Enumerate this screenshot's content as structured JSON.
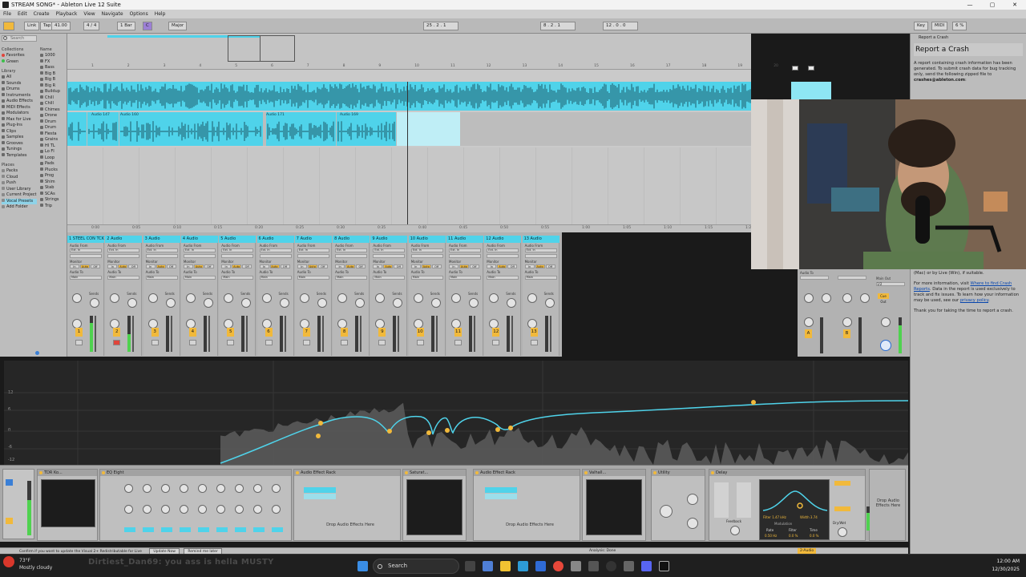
{
  "window": {
    "title": "STREAM SONG* - Ableton Live 12 Suite",
    "min": "—",
    "max": "▢",
    "close": "✕"
  },
  "menu": [
    "File",
    "Edit",
    "Create",
    "Playback",
    "View",
    "Navigate",
    "Options",
    "Help"
  ],
  "transport": {
    "link": "Link",
    "tap": "Tap",
    "tempo": "41.00",
    "signature": "4 / 4",
    "quantize": "1 Bar",
    "key": "C",
    "scale": "Major",
    "position": "25 . 2 . 1",
    "loop_start": "8 . 2 . 1",
    "loop_length": "12 . 0 . 0",
    "key_map": "Key",
    "midi_map": "MIDI",
    "cpu": "6 %"
  },
  "browser": {
    "search_placeholder": "Search",
    "name_header": "Name",
    "collections_header": "Collections",
    "collections": [
      {
        "label": "Favorites",
        "color": "#e0443a"
      },
      {
        "label": "Green",
        "color": "#3cbf4a"
      }
    ],
    "library_header": "Library",
    "library": [
      "All",
      "Sounds",
      "Drums",
      "Instruments",
      "Audio Effects",
      "MIDI Effects",
      "Modulators",
      "Max for Live",
      "Plug-Ins",
      "Clips",
      "Samples",
      "Grooves",
      "Tunings",
      "Templates"
    ],
    "places_header": "Places",
    "places": [
      "Packs",
      "Cloud",
      "Push",
      "User Library",
      "Current Project",
      "Vocal Presets",
      "Add Folder"
    ],
    "names": [
      "1000",
      "FX",
      "Bass",
      "Big B",
      "Big B",
      "Big R",
      "Buildup",
      "Chill",
      "Chill",
      "Chimes",
      "Drone",
      "Drum",
      "Drum",
      "Fiesta",
      "Grains",
      "HI TL",
      "Lo FI",
      "Loop",
      "Pads",
      "Plucks",
      "Prog",
      "Shim",
      "Stab",
      "SCAs",
      "Strings",
      "Trip"
    ]
  },
  "arrangement": {
    "bars": [
      "1",
      "2",
      "3",
      "4",
      "5",
      "6",
      "7",
      "8",
      "9",
      "10",
      "11",
      "12",
      "13",
      "14",
      "15",
      "16",
      "17",
      "18",
      "19",
      "20"
    ],
    "times": [
      "0:00",
      "0:05",
      "0:10",
      "0:15",
      "0:20",
      "0:25",
      "0:30",
      "0:35",
      "0:40",
      "0:45",
      "0:50",
      "0:55",
      "1:00",
      "1:05",
      "1:10",
      "1:15",
      "1:20"
    ],
    "clips": [
      "Audio 147",
      "Audio 160",
      "Audio 171",
      "Audio 169"
    ]
  },
  "mixer": {
    "tracks": [
      {
        "name": "1 STEEL CON TCK",
        "num": "1",
        "meter": 0.8
      },
      {
        "name": "2 Audio",
        "num": "2",
        "meter": 0.5
      },
      {
        "name": "3 Audio",
        "num": "3",
        "meter": 0
      },
      {
        "name": "4 Audio",
        "num": "4",
        "meter": 0
      },
      {
        "name": "5 Audio",
        "num": "5",
        "meter": 0
      },
      {
        "name": "6 Audio",
        "num": "6",
        "meter": 0
      },
      {
        "name": "7 Audio",
        "num": "7",
        "meter": 0
      },
      {
        "name": "8 Audio",
        "num": "8",
        "meter": 0
      },
      {
        "name": "9 Audio",
        "num": "9",
        "meter": 0
      },
      {
        "name": "10 Audio",
        "num": "10",
        "meter": 0
      },
      {
        "name": "11 Audio",
        "num": "11",
        "meter": 0
      },
      {
        "name": "12 Audio",
        "num": "12",
        "meter": 0
      },
      {
        "name": "13 Audio",
        "num": "13",
        "meter": 0
      }
    ],
    "audio_from": "Audio From",
    "input": "Ext. In",
    "monitor": "Monitor",
    "monitor_opts": [
      "In",
      "Auto",
      "Off"
    ],
    "audio_to": "Audio To",
    "out": "Main",
    "sends": "Sends",
    "returns": [
      {
        "num": "A"
      },
      {
        "num": "B"
      }
    ],
    "master": "Main Out",
    "master_route": "1/2",
    "cue_out": "Cue Out"
  },
  "eq": {
    "db_labels": [
      "12",
      "6",
      "0",
      "-6",
      "-12"
    ]
  },
  "devices": [
    {
      "title": "TDR Ko..."
    },
    {
      "title": "EQ Eight"
    },
    {
      "title": "Audio Effect Rack",
      "drop": "Drop Audio Effects Here"
    },
    {
      "title": "Saturat..."
    },
    {
      "title": "Audio Effect Rack",
      "drop": "Drop Audio Effects Here"
    },
    {
      "title": "Valhall..."
    },
    {
      "title": "Utility"
    },
    {
      "title": "Delay"
    }
  ],
  "delay": {
    "filter": "Filter",
    "freq": "1.47 kHz",
    "width": "Width",
    "width_val": "3.74",
    "rate": "Rate",
    "filter_lbl": "Filter",
    "time": "Time",
    "rate_val": "0.50 Hz",
    "filter_val": "0.0 %",
    "time_val": "0.0 %",
    "modulation": "Modulation",
    "feedback": "Feedback",
    "dry_wet": "Dry/Wet"
  },
  "right_drop": "Drop Audio Effects Here",
  "status": {
    "message": "Confirm if you want to update the Visual 2+ Redistributable for Live",
    "btn1": "Update Now",
    "btn2": "Remind me later",
    "analysis": "Analysis: Done",
    "track": "2-Audio"
  },
  "crash": {
    "panel": "Report a Crash",
    "title": "Report a Crash",
    "p1": "A report containing crash information has been generated. To submit crash data for bug tracking only, send the following zipped file to",
    "email": "crashes@ableton.com",
    "p1_end": ":",
    "p2a": "(Mac) or by Live (Win), if suitable.",
    "p3_start": "For more information, visit",
    "p3_link": "Where to find Crash Reports",
    "p3_mid": ". Data in the report is used exclusively to track and fix issues. To learn how your information may be used, see our",
    "p3_link2": "privacy policy",
    "p3_end": ".",
    "p4": "Thank you for taking the time to report a crash."
  },
  "taskbar": {
    "weather_temp": "73°F",
    "weather_desc": "Mostly cloudy",
    "chat": "Dirtiest_Dan69: you ass is hella MUSTY",
    "search": "Search",
    "time": "12:00 AM",
    "date": "12/30/2025"
  }
}
